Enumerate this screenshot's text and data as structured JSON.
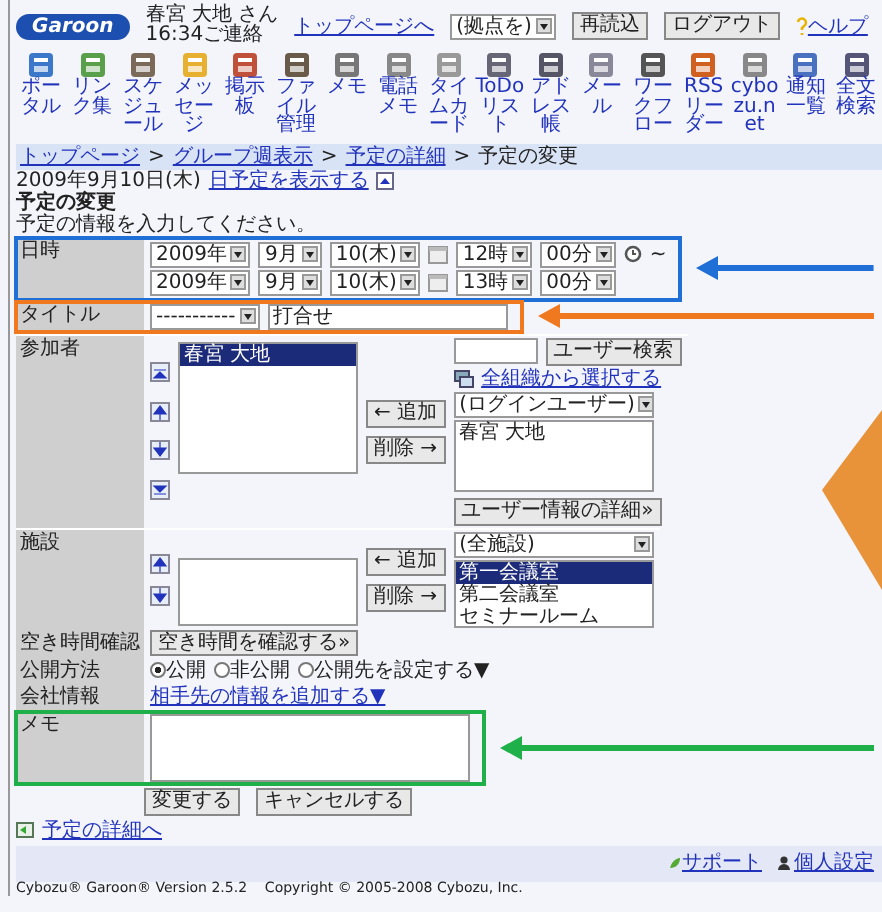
{
  "header": {
    "logo": "Garoon",
    "user_name": "春宮 大地 さん",
    "user_note": "16:34ご連絡",
    "top_link": "トップページへ",
    "location_select": "(拠点を)",
    "buttons": [
      "再読込",
      "ログアウト"
    ],
    "help": "ヘルプ"
  },
  "toolbar": [
    {
      "label": "ポータル"
    },
    {
      "label": "リンク集"
    },
    {
      "label": "スケジュール"
    },
    {
      "label": "メッセージ"
    },
    {
      "label": "掲示板"
    },
    {
      "label": "ファイル管理"
    },
    {
      "label": "メモ"
    },
    {
      "label": "電話メモ"
    },
    {
      "label": "タイムカード"
    },
    {
      "label": "ToDoリスト"
    },
    {
      "label": "アドレス帳"
    },
    {
      "label": "メール"
    },
    {
      "label": "ワークフロー"
    },
    {
      "label": "RSSリーダー"
    },
    {
      "label": "cybozu.net"
    },
    {
      "label": "通知一覧"
    },
    {
      "label": "全文検索"
    }
  ],
  "breadcrumb": {
    "separator": ">",
    "items": [
      {
        "label": "トップページ",
        "link": true
      },
      {
        "label": "グループ週表示",
        "link": true
      },
      {
        "label": "予定の詳細",
        "link": true
      },
      {
        "label": "予定の変更",
        "link": false
      }
    ]
  },
  "date_line": {
    "date": "2009年9月10日(木)",
    "link": "日予定を表示する"
  },
  "page_title": "予定の変更",
  "instruction": "予定の情報を入力してください。",
  "form": [
    {
      "kind": "datetime",
      "label": "日時",
      "color": "#1f6fd6",
      "range_mark": "~",
      "lines": [
        [
          "2009年",
          "9月",
          "10(木)",
          "12時",
          "00分"
        ],
        [
          "2009年",
          "9月",
          "10(木)",
          "13時",
          "00分"
        ]
      ]
    },
    {
      "kind": "title",
      "label": "タイトル",
      "color": "#f0781e",
      "menu": "-----------",
      "value": "打合せ"
    },
    {
      "kind": "participants",
      "label": "参加者",
      "chosen": [
        {
          "label": "春宮 大地",
          "selected": true
        }
      ],
      "add": "← 追加",
      "remove": "削除 →",
      "search_button": "ユーザー検索",
      "org_link": "全組織から選択する",
      "group_select": "(ログインユーザー)",
      "candidates": [
        {
          "label": "春宮 大地",
          "selected": false
        }
      ],
      "detail_button": "ユーザー情報の詳細»"
    },
    {
      "kind": "facilities",
      "label": "施設",
      "add": "← 追加",
      "remove": "削除 →",
      "group_select": "(全施設)",
      "candidates": [
        {
          "label": "第一会議室",
          "selected": true
        },
        {
          "label": "第二会議室",
          "selected": false
        },
        {
          "label": "セミナールーム",
          "selected": false
        }
      ]
    },
    {
      "kind": "button",
      "label": "空き時間確認",
      "button": "空き時間を確認する»"
    },
    {
      "kind": "radios",
      "label": "公開方法",
      "options": [
        {
          "label": "公開",
          "selected": true
        },
        {
          "label": "非公開",
          "selected": false
        },
        {
          "label": "公開先を設定する▼",
          "selected": false
        }
      ]
    },
    {
      "kind": "link",
      "label": "会社情報",
      "link": "相手先の情報を追加する▼"
    },
    {
      "kind": "memo",
      "label": "メモ",
      "color": "#1fb04a"
    }
  ],
  "actions": [
    "変更する",
    "キャンセルする"
  ],
  "back_link": "予定の詳細へ",
  "footer": {
    "links": [
      "サポート",
      "個人設定"
    ],
    "copyright": "Cybozu® Garoon® Version 2.5.2    Copyright © 2005-2008 Cybozu, Inc."
  }
}
